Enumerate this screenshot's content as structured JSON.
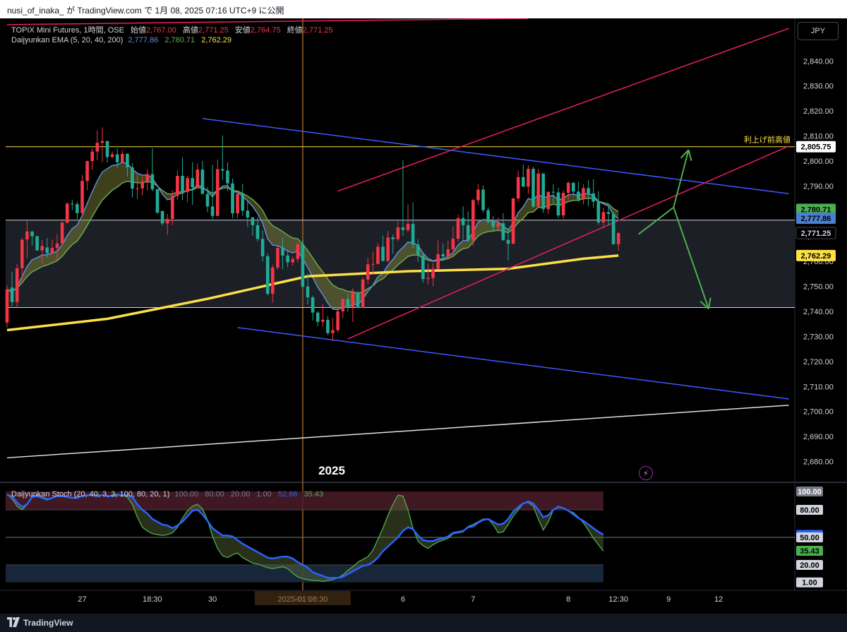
{
  "header": {
    "title": "nusi_of_inaka_ が TradingView.com で 1月 08, 2025 07:16 UTC+9 に公開"
  },
  "footer": {
    "brand": "TradingView"
  },
  "toolbar": {
    "currency_button": "JPY"
  },
  "main_legend": {
    "symbol_line": "TOPIX Mini Futures, 1時間, OSE",
    "open_label": "始値",
    "open": "2,767.00",
    "high_label": "高値",
    "high": "2,771.25",
    "low_label": "安値",
    "low": "2,764.75",
    "close_label": "終値",
    "close": "2,771.25",
    "ema_name": "Daijyunkan EMA (5, 20, 40, 200)",
    "ema_values": [
      "2,777.86",
      "2,780.71",
      "2,762.29"
    ]
  },
  "stoch_legend": {
    "name": "Daijyunkan Stoch (20, 40, 3, 3, 100, 80, 20, 1)",
    "values": [
      "100.00",
      "80.00",
      "20.00",
      "1.00"
    ],
    "k_value": "52.66",
    "d_value": "35.43"
  },
  "annotations": {
    "year_label": "2025",
    "resistance_label": "利上げ前高値",
    "resistance_price": "2,805.75"
  },
  "price_badges": [
    {
      "label": "2,805.75",
      "bg": "#ffffff",
      "fg": "#000000",
      "price": 2805.75
    },
    {
      "label": "2,780.71",
      "bg": "#4caf50",
      "fg": "#000000",
      "price": 2780.71
    },
    {
      "label": "2,777.86",
      "bg": "#4a7fd0",
      "fg": "#000000",
      "price": 2777.2
    },
    {
      "label": "2,771.25",
      "bg": "#000000",
      "fg": "#d1d4dc",
      "price": 2771.25
    },
    {
      "label": "2,762.29",
      "bg": "#fde047",
      "fg": "#000000",
      "price": 2762.29
    }
  ],
  "stoch_badges": [
    {
      "label": "100.00",
      "bg": "#787b86",
      "fg": "#ffffff",
      "value": 100
    },
    {
      "label": "80.00",
      "bg": "#d1d4dc",
      "fg": "#000000",
      "value": 80
    },
    {
      "label": "52.66",
      "bg": "#2962ff",
      "fg": "#ffffff",
      "value": 52.66
    },
    {
      "label": "50.00",
      "bg": "#d1d4dc",
      "fg": "#000000",
      "value": 50
    },
    {
      "label": "35.43",
      "bg": "#4caf50",
      "fg": "#000000",
      "value": 35.43
    },
    {
      "label": "20.00",
      "bg": "#d1d4dc",
      "fg": "#000000",
      "value": 20
    },
    {
      "label": "1.00",
      "bg": "#d1d4dc",
      "fg": "#000000",
      "value": 1
    }
  ],
  "colors": {
    "up": "#f23645",
    "down": "#22ab94",
    "ema_fast": "#5b8fd6",
    "ema_mid": "#6aa84f",
    "ema200": "#fde047",
    "channel_blue": "#3d5afe",
    "channel_red": "#e91e63",
    "trend_white": "#e0e0e0",
    "arrow": "#4caf50"
  },
  "chart_data": {
    "type": "candlestick",
    "symbol": "TOPIX Mini Futures",
    "interval": "1時間",
    "exchange": "OSE",
    "currency": "JPY",
    "y_axis": {
      "ticks": [
        2680,
        2690,
        2700,
        2710,
        2720,
        2730,
        2740,
        2750,
        2760,
        2770,
        2780,
        2790,
        2800,
        2810,
        2820,
        2830,
        2840
      ],
      "tick_labels": [
        "2,680.00",
        "2,690.00",
        "2,700.00",
        "2,710.00",
        "2,720.00",
        "2,730.00",
        "2,740.00",
        "2,750.00",
        "2,760.00",
        "2,770.00",
        "2,780.00",
        "2,790.00",
        "2,800.00",
        "2,810.00",
        "2,820.00",
        "2,830.00",
        "2,840.00"
      ],
      "range": [
        2672,
        2857
      ]
    },
    "x_axis": {
      "ticks": [
        {
          "label": "27",
          "index": 15
        },
        {
          "label": "18:30",
          "index": 29
        },
        {
          "label": "30",
          "index": 41
        },
        {
          "label": "2025",
          "index": 59
        },
        {
          "label": "6",
          "index": 79
        },
        {
          "label": "7",
          "index": 93
        },
        {
          "label": "8",
          "index": 112
        },
        {
          "label": "12:30",
          "index": 122
        },
        {
          "label": "9",
          "index": 132
        },
        {
          "label": "12",
          "index": 142
        }
      ],
      "crosshair_label": "2025-01 08:30",
      "crosshair_index": 59
    },
    "candles": [
      [
        2735.5,
        2750.2,
        2733.5,
        2748.7
      ],
      [
        2749.5,
        2755.8,
        2742.1,
        2743.7
      ],
      [
        2743.7,
        2759.0,
        2741.2,
        2757.2
      ],
      [
        2757.2,
        2769.3,
        2752.6,
        2768.6
      ],
      [
        2768.7,
        2776.2,
        2761.3,
        2771.9
      ],
      [
        2771.9,
        2772.0,
        2766.3,
        2770.0
      ],
      [
        2770.0,
        2770.1,
        2764.3,
        2764.3
      ],
      [
        2764.3,
        2768.4,
        2759.2,
        2766.1
      ],
      [
        2765.5,
        2769.3,
        2761.3,
        2763.2
      ],
      [
        2763.2,
        2768.7,
        2763.1,
        2765.3
      ],
      [
        2765.3,
        2770.8,
        2760.5,
        2767.1
      ],
      [
        2767.1,
        2776.0,
        2766.3,
        2775.4
      ],
      [
        2775.4,
        2783.5,
        2775.2,
        2783.0
      ],
      [
        2783.0,
        2784.6,
        2780.4,
        2782.8
      ],
      [
        2782.8,
        2783.7,
        2776.8,
        2779.2
      ],
      [
        2779.2,
        2794.4,
        2778.3,
        2792.1
      ],
      [
        2792.1,
        2800.2,
        2788.4,
        2800.0
      ],
      [
        2800.0,
        2805.1,
        2796.4,
        2803.8
      ],
      [
        2803.8,
        2812.3,
        2800.4,
        2807.3
      ],
      [
        2807.3,
        2813.5,
        2799.5,
        2808.0
      ],
      [
        2808.0,
        2808.1,
        2799.4,
        2801.6
      ],
      [
        2801.6,
        2803.8,
        2801.2,
        2802.7
      ],
      [
        2802.7,
        2805.0,
        2797.1,
        2799.5
      ],
      [
        2799.5,
        2804.2,
        2799.1,
        2802.9
      ],
      [
        2802.9,
        2803.2,
        2793.8,
        2797.5
      ],
      [
        2797.5,
        2799.1,
        2785.4,
        2789.0
      ],
      [
        2789.0,
        2795.6,
        2784.7,
        2789.1
      ],
      [
        2789.1,
        2793.6,
        2786.3,
        2791.8
      ],
      [
        2791.8,
        2796.8,
        2788.3,
        2794.8
      ],
      [
        2794.8,
        2805.1,
        2787.9,
        2788.7
      ],
      [
        2788.7,
        2789.0,
        2779.0,
        2779.4
      ],
      [
        2780.0,
        2780.3,
        2774.3,
        2775.1
      ],
      [
        2775.1,
        2778.9,
        2770.4,
        2776.9
      ],
      [
        2776.9,
        2788.4,
        2774.4,
        2786.1
      ],
      [
        2786.1,
        2796.3,
        2784.5,
        2794.1
      ],
      [
        2794.1,
        2801.5,
        2784.5,
        2787.7
      ],
      [
        2787.7,
        2794.1,
        2783.5,
        2793.2
      ],
      [
        2793.2,
        2799.6,
        2782.5,
        2789.6
      ],
      [
        2789.6,
        2799.1,
        2789.3,
        2796.6
      ],
      [
        2796.6,
        2800.1,
        2786.7,
        2786.9
      ],
      [
        2786.9,
        2789.6,
        2779.5,
        2781.9
      ],
      [
        2781.9,
        2798.5,
        2776.8,
        2778.1
      ],
      [
        2778.1,
        2800.6,
        2778.0,
        2796.8
      ],
      [
        2796.8,
        2810.2,
        2792.4,
        2796.2
      ],
      [
        2796.2,
        2799.5,
        2788.0,
        2791.1
      ],
      [
        2791.1,
        2793.0,
        2777.2,
        2779.1
      ],
      [
        2779.1,
        2788.4,
        2777.1,
        2787.0
      ],
      [
        2787.0,
        2791.0,
        2778.1,
        2780.2
      ],
      [
        2780.2,
        2783.9,
        2773.7,
        2777.5
      ],
      [
        2777.5,
        2777.7,
        2770.2,
        2774.4
      ],
      [
        2774.4,
        2777.7,
        2767.9,
        2768.9
      ],
      [
        2768.9,
        2772.3,
        2759.8,
        2762.0
      ],
      [
        2762.0,
        2763.1,
        2746.3,
        2747.0
      ],
      [
        2747.0,
        2758.5,
        2743.5,
        2757.5
      ],
      [
        2757.5,
        2766.0,
        2756.6,
        2765.3
      ],
      [
        2765.3,
        2769.5,
        2756.8,
        2762.3
      ],
      [
        2762.3,
        2763.8,
        2757.6,
        2759.6
      ],
      [
        2759.6,
        2761.9,
        2758.3,
        2760.9
      ],
      [
        2760.9,
        2767.4,
        2759.5,
        2766.8
      ],
      [
        2766.8,
        2768.5,
        2749.1,
        2749.9
      ],
      [
        2749.9,
        2755.1,
        2742.8,
        2745.6
      ],
      [
        2745.6,
        2746.3,
        2736.4,
        2739.5
      ],
      [
        2739.5,
        2740.0,
        2734.0,
        2735.8
      ],
      [
        2735.8,
        2742.8,
        2733.7,
        2736.6
      ],
      [
        2736.6,
        2738.1,
        2730.6,
        2731.3
      ],
      [
        2731.3,
        2737.3,
        2728.1,
        2732.5
      ],
      [
        2732.5,
        2741.7,
        2731.5,
        2740.0
      ],
      [
        2740.0,
        2745.0,
        2737.3,
        2744.9
      ],
      [
        2744.9,
        2747.0,
        2739.8,
        2741.6
      ],
      [
        2741.6,
        2749.2,
        2735.7,
        2747.6
      ],
      [
        2747.6,
        2748.1,
        2741.2,
        2741.4
      ],
      [
        2741.4,
        2753.4,
        2741.3,
        2752.7
      ],
      [
        2752.7,
        2761.5,
        2750.9,
        2758.8
      ],
      [
        2758.8,
        2763.8,
        2754.9,
        2758.9
      ],
      [
        2758.9,
        2767.2,
        2758.9,
        2765.8
      ],
      [
        2765.8,
        2770.2,
        2759.9,
        2760.1
      ],
      [
        2760.1,
        2772.1,
        2759.6,
        2769.5
      ],
      [
        2769.5,
        2770.7,
        2763.0,
        2768.8
      ],
      [
        2768.8,
        2776.0,
        2768.1,
        2773.5
      ],
      [
        2773.5,
        2800.4,
        2770.2,
        2772.5
      ],
      [
        2772.5,
        2782.7,
        2771.5,
        2774.9
      ],
      [
        2774.9,
        2783.5,
        2765.2,
        2766.7
      ],
      [
        2766.7,
        2768.8,
        2759.8,
        2762.3
      ],
      [
        2762.3,
        2763.1,
        2751.5,
        2752.9
      ],
      [
        2752.9,
        2759.1,
        2750.7,
        2753.3
      ],
      [
        2753.3,
        2759.2,
        2750.0,
        2757.0
      ],
      [
        2757.0,
        2768.3,
        2756.8,
        2762.8
      ],
      [
        2762.8,
        2767.1,
        2760.1,
        2761.9
      ],
      [
        2761.9,
        2768.3,
        2761.5,
        2764.8
      ],
      [
        2764.8,
        2774.0,
        2762.0,
        2769.0
      ],
      [
        2769.0,
        2778.5,
        2767.6,
        2777.2
      ],
      [
        2777.2,
        2781.9,
        2768.6,
        2774.4
      ],
      [
        2774.4,
        2779.9,
        2767.8,
        2768.3
      ],
      [
        2768.3,
        2784.9,
        2766.3,
        2784.4
      ],
      [
        2784.4,
        2790.7,
        2782.4,
        2788.6
      ],
      [
        2788.6,
        2790.3,
        2779.4,
        2780.4
      ],
      [
        2780.4,
        2781.5,
        2775.2,
        2775.7
      ],
      [
        2775.7,
        2778.0,
        2772.2,
        2773.8
      ],
      [
        2773.8,
        2777.5,
        2771.8,
        2775.2
      ],
      [
        2775.2,
        2779.2,
        2768.1,
        2768.5
      ],
      [
        2768.5,
        2772.7,
        2760.3,
        2767.0
      ],
      [
        2767.0,
        2785.3,
        2766.8,
        2785.1
      ],
      [
        2785.1,
        2796.2,
        2783.8,
        2793.6
      ],
      [
        2793.6,
        2798.6,
        2789.7,
        2789.8
      ],
      [
        2789.8,
        2798.3,
        2786.9,
        2796.9
      ],
      [
        2796.9,
        2797.7,
        2781.3,
        2781.8
      ],
      [
        2781.8,
        2796.9,
        2781.8,
        2795.0
      ],
      [
        2795.0,
        2795.2,
        2779.3,
        2780.8
      ],
      [
        2780.8,
        2787.9,
        2778.8,
        2787.7
      ],
      [
        2787.7,
        2790.8,
        2782.6,
        2787.5
      ],
      [
        2787.5,
        2789.4,
        2777.3,
        2778.3
      ],
      [
        2778.3,
        2788.4,
        2777.0,
        2787.3
      ],
      [
        2787.3,
        2792.0,
        2784.6,
        2791.3
      ],
      [
        2791.3,
        2791.7,
        2786.0,
        2787.8
      ],
      [
        2787.8,
        2791.7,
        2783.8,
        2784.7
      ],
      [
        2784.7,
        2790.7,
        2782.7,
        2789.2
      ],
      [
        2789.2,
        2792.4,
        2782.0,
        2787.1
      ],
      [
        2787.1,
        2792.8,
        2781.4,
        2783.8
      ],
      [
        2783.8,
        2788.0,
        2774.6,
        2775.5
      ],
      [
        2775.5,
        2781.4,
        2773.3,
        2779.6
      ],
      [
        2779.6,
        2782.1,
        2774.5,
        2778.9
      ],
      [
        2778.9,
        2779.6,
        2766.7,
        2766.8
      ],
      [
        2766.8,
        2771.7,
        2764.3,
        2771.2
      ]
    ],
    "ema200_points": [
      [
        0,
        2732.5
      ],
      [
        20,
        2737
      ],
      [
        40,
        2745
      ],
      [
        60,
        2754
      ],
      [
        80,
        2756
      ],
      [
        100,
        2757
      ],
      [
        115,
        2761
      ],
      [
        122,
        2762.29
      ]
    ],
    "trend_lines": [
      {
        "name": "upper-descending-blue",
        "color": "#3d5afe",
        "p1": [
          39,
          2817
        ],
        "p2": [
          156,
          2787
        ]
      },
      {
        "name": "lower-descending-blue",
        "color": "#3d5afe",
        "p1": [
          46,
          2733.5
        ],
        "p2": [
          156,
          2705
        ]
      },
      {
        "name": "red-channel-upper",
        "color": "#e91e63",
        "p1": [
          66,
          2788
        ],
        "p2": [
          156,
          2853
        ]
      },
      {
        "name": "red-channel-lower",
        "color": "#e91e63",
        "p1": [
          68,
          2729
        ],
        "p2": [
          156,
          2806
        ]
      },
      {
        "name": "red-top-edge",
        "color": "#e91e63",
        "p1": [
          0,
          2854.5
        ],
        "p2": [
          104,
          2857
        ]
      },
      {
        "name": "white-ascending",
        "color": "#e0e0e0",
        "p1": [
          0,
          2681.5
        ],
        "p2": [
          156,
          2702.5
        ]
      }
    ],
    "horizontal_levels": [
      {
        "name": "resistance",
        "price": 2805.75,
        "color": "#fde047"
      },
      {
        "name": "last-price",
        "price": 2776.4,
        "color": "#d1d4dc"
      },
      {
        "name": "support",
        "price": 2741.5,
        "color": "#d1d4dc"
      }
    ],
    "projection_arrows": [
      {
        "name": "bullish-scenario",
        "points": [
          [
            126,
            2770.8
          ],
          [
            133,
            2781.5
          ],
          [
            136,
            2804.5
          ]
        ],
        "color": "#4caf50"
      },
      {
        "name": "bearish-scenario",
        "points": [
          [
            133,
            2781.5
          ],
          [
            140,
            2741
          ]
        ],
        "color": "#4caf50"
      }
    ],
    "stochastic": {
      "k_series": [
        96,
        95,
        88,
        83,
        86,
        94,
        95,
        93,
        91,
        93,
        95,
        95,
        94,
        93,
        93,
        95,
        96,
        96,
        95,
        96,
        95,
        95,
        96,
        96,
        96,
        94,
        86,
        80,
        76,
        70,
        67,
        64,
        63,
        60,
        63,
        67,
        73,
        79,
        80,
        75,
        68,
        60,
        56,
        52,
        52,
        51,
        47,
        43,
        40,
        37,
        34,
        31,
        28,
        27,
        28,
        29,
        29,
        27,
        23,
        20,
        17,
        12,
        10,
        8,
        6,
        6,
        6,
        7,
        10,
        13,
        16,
        19,
        20,
        23,
        28,
        35,
        40,
        45,
        50,
        57,
        61,
        59,
        52,
        47,
        46,
        46,
        48,
        49,
        51,
        55,
        56,
        57,
        61,
        62,
        66,
        69,
        70,
        67,
        64,
        65,
        70,
        78,
        83,
        87,
        89,
        87,
        80,
        72,
        74,
        80,
        83,
        82,
        79,
        75,
        71,
        68,
        64,
        60,
        56,
        53
      ],
      "d_series": [
        97,
        92,
        84,
        80,
        86,
        95,
        96,
        94,
        92,
        93,
        95,
        95,
        94,
        93,
        94,
        95,
        96,
        96,
        96,
        96,
        95,
        96,
        97,
        96,
        94,
        86,
        72,
        61,
        57,
        54,
        53,
        52,
        53,
        55,
        61,
        71,
        79,
        84,
        86,
        81,
        69,
        51,
        38,
        30,
        28,
        31,
        33,
        28,
        25,
        22,
        21,
        19,
        17,
        16,
        17,
        18,
        16,
        11,
        7,
        5,
        4,
        3,
        3,
        2,
        3,
        4,
        6,
        9,
        14,
        18,
        23,
        26,
        29,
        36,
        48,
        60,
        74,
        86,
        96,
        95,
        80,
        60,
        46,
        41,
        38,
        42,
        45,
        47,
        49,
        54,
        55,
        56,
        62,
        64,
        67,
        70,
        70,
        64,
        55,
        56,
        64,
        73,
        80,
        87,
        88,
        84,
        70,
        58,
        67,
        80,
        84,
        82,
        79,
        77,
        72,
        66,
        58,
        49,
        42,
        35
      ],
      "overbought": 80,
      "oversold": 20,
      "mid": 50
    }
  }
}
